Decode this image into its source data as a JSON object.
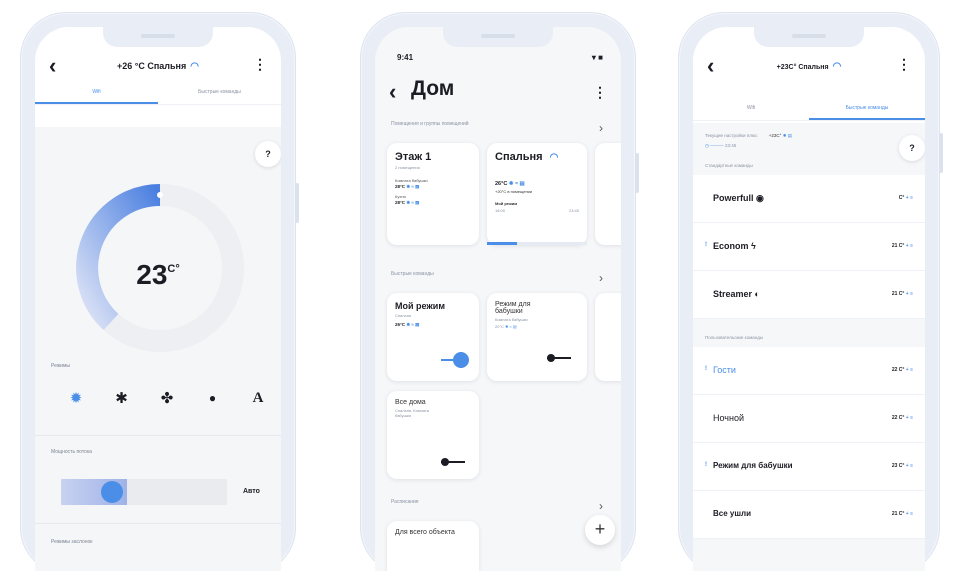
{
  "phone1": {
    "back_icon": "‹",
    "title": "+26 °C Спальня",
    "tabs": [
      "Wifi",
      "Быстрые команды"
    ],
    "help": "?",
    "temperature": "23",
    "temp_unit": "C°",
    "dial_level": 0.45,
    "modes_label": "Режимы",
    "modes": [
      "sun-icon",
      "snowflake-icon",
      "fan-icon",
      "drop-icon",
      "auto-icon"
    ],
    "modes_glyphs": [
      "✹",
      "✱",
      "✤",
      "●",
      "A"
    ],
    "auto_letter": "A",
    "power_label": "Мощность потока",
    "power_level": 0.4,
    "power_value": "Авто",
    "louvre_label": "Режимы заслонок"
  },
  "phone2": {
    "time": "9:41",
    "status": "▾ ■",
    "title": "Дом",
    "rooms_section": "Помещения и группы помещений",
    "floor_card": {
      "title": "Этаж 1",
      "sub": "2 помещения",
      "room1": "Комната бабушки",
      "room1_temp": "28°С",
      "room2": "Кухня",
      "room2_temp": "28°С"
    },
    "bedroom_card": {
      "title": "Спальня",
      "temp": "26°С",
      "desc": "+20°С в помещении",
      "mode": "Мой режим",
      "mode_from": "18:00",
      "mode_to": "23:45",
      "progress": 0.3
    },
    "quick_section": "Быстрые команды",
    "my_mode_card": {
      "title": "Мой режим",
      "sub": "Спальня",
      "temp": "26°С"
    },
    "granny_card": {
      "title": "Режим для бабушки",
      "sub": "Комната бабушки",
      "temp": "20°С"
    },
    "all_home_card": {
      "title": "Все дома",
      "sub": "Спальня, Комната бабушки"
    },
    "schedule_section": "Расписания",
    "object_card": {
      "title": "Для всего объекта"
    },
    "fab": "+"
  },
  "phone3": {
    "title": "+23C° Спальня",
    "tabs": [
      "Wifi",
      "Быстрые команды"
    ],
    "current_label": "Текущие настройки плюс",
    "current_temp": "+23C°",
    "current_time": "23:45",
    "help": "?",
    "standard_label": "Стандартные команды",
    "custom_label": "Пользовательские команды",
    "rows": [
      {
        "name": "Powerfull",
        "icon": "power-icon",
        "glyph": "◉",
        "val": "C°",
        "marked": false,
        "bold": true
      },
      {
        "name": "Econom",
        "icon": "bolt-icon",
        "glyph": "ϟ",
        "val": "21 C°",
        "marked": true,
        "bold": true
      },
      {
        "name": "Streamer",
        "icon": "stream-icon",
        "glyph": "◐",
        "val": "21 C°",
        "marked": false,
        "bold": true
      },
      {
        "name": "Гости",
        "icon": "",
        "glyph": "",
        "val": "22 C°",
        "marked": true,
        "bold": false,
        "blue": true
      },
      {
        "name": "Ночной",
        "icon": "",
        "glyph": "",
        "val": "22 C°",
        "marked": false,
        "bold": false
      },
      {
        "name": "Режим для бабушки",
        "icon": "",
        "glyph": "",
        "val": "23 C°",
        "marked": true,
        "bold": true
      },
      {
        "name": "Все ушли",
        "icon": "",
        "glyph": "",
        "val": "21 C°",
        "marked": false,
        "bold": true
      }
    ],
    "row_mark": "!",
    "row_icons": "+ ≡"
  },
  "colors": {
    "accent": "#4a8ee8",
    "phone_frame": "#e9eef6",
    "dial_gradient_start": "#4a7fe0",
    "dial_gradient_end": "#dde3f6"
  }
}
